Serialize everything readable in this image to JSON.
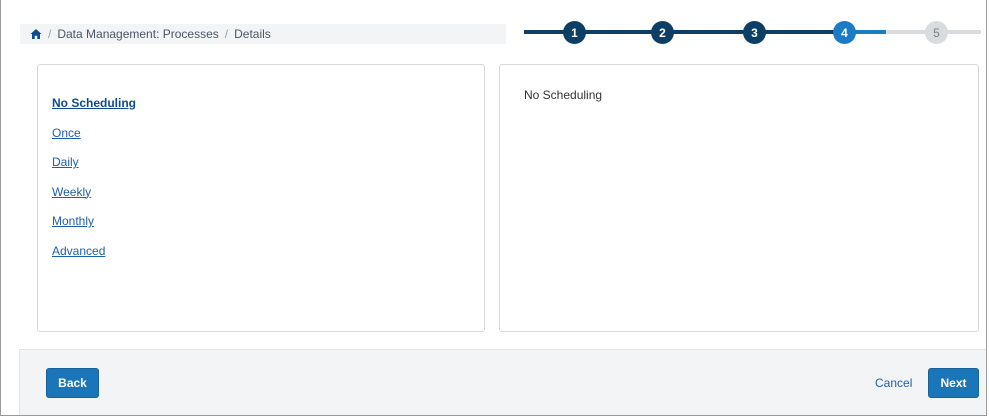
{
  "breadcrumb": {
    "items": [
      "Data Management: Processes",
      "Details"
    ],
    "separator": "/"
  },
  "stepper": {
    "steps": [
      {
        "label": "1",
        "state": "complete"
      },
      {
        "label": "2",
        "state": "complete"
      },
      {
        "label": "3",
        "state": "complete"
      },
      {
        "label": "4",
        "state": "current"
      },
      {
        "label": "5",
        "state": "upcoming"
      }
    ],
    "colors": {
      "complete": "#0d3f66",
      "current": "#1b7bc4",
      "upcoming": "#d9dcdf",
      "upcoming_text": "#7a7f85"
    }
  },
  "schedule_options": {
    "items": [
      "No Scheduling",
      "Once",
      "Daily",
      "Weekly",
      "Monthly",
      "Advanced"
    ],
    "selected": "No Scheduling"
  },
  "detail": {
    "text": "No Scheduling"
  },
  "footer": {
    "back_label": "Back",
    "cancel_label": "Cancel",
    "next_label": "Next"
  },
  "icons": {
    "home": "home-icon"
  },
  "colors": {
    "primary": "#1b75b9",
    "link": "#1f5fa8"
  }
}
